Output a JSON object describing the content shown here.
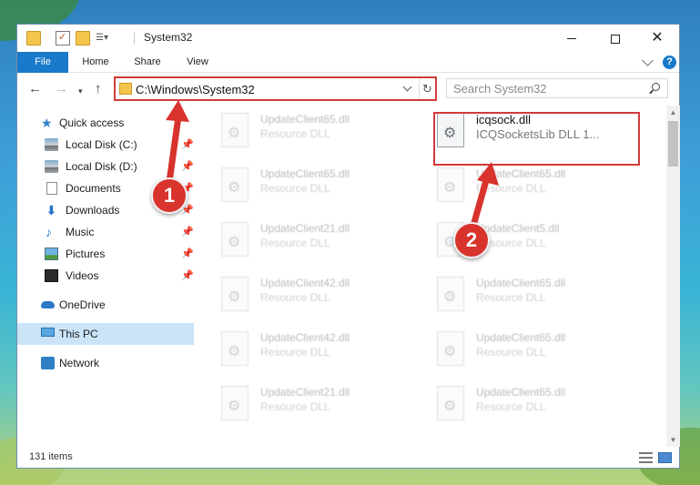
{
  "window": {
    "title": "System32"
  },
  "ribbon": {
    "tabs": [
      "File",
      "Home",
      "Share",
      "View"
    ]
  },
  "address_bar": {
    "path": "C:\\Windows\\System32"
  },
  "search": {
    "placeholder": "Search System32"
  },
  "nav_pane": {
    "items": [
      {
        "label": "Quick access",
        "icon": "star-icon",
        "pinned": false
      },
      {
        "label": "Local Disk (C:)",
        "icon": "drive-icon",
        "pinned": true
      },
      {
        "label": "Local Disk (D:)",
        "icon": "drive-icon",
        "pinned": true
      },
      {
        "label": "Documents",
        "icon": "documents-icon",
        "pinned": true
      },
      {
        "label": "Downloads",
        "icon": "download-icon",
        "pinned": true
      },
      {
        "label": "Music",
        "icon": "music-icon",
        "pinned": true
      },
      {
        "label": "Pictures",
        "icon": "pictures-icon",
        "pinned": true
      },
      {
        "label": "Videos",
        "icon": "videos-icon",
        "pinned": true
      },
      {
        "label": "OneDrive",
        "icon": "cloud-icon",
        "pinned": false
      },
      {
        "label": "This PC",
        "icon": "computer-icon",
        "pinned": false,
        "selected": true
      },
      {
        "label": "Network",
        "icon": "network-icon",
        "pinned": false
      }
    ]
  },
  "files": {
    "left_column": [
      {
        "name": "UpdateClient65.dll",
        "type": "Resource DLL"
      },
      {
        "name": "UpdateClient65.dll",
        "type": "Resource DLL"
      },
      {
        "name": "UpdateClient21.dll",
        "type": "Resource DLL"
      },
      {
        "name": "UpdateClient42.dll",
        "type": "Resource DLL"
      },
      {
        "name": "UpdateClient42.dll",
        "type": "Resource DLL"
      },
      {
        "name": "UpdateClient21.dll",
        "type": "Resource DLL"
      }
    ],
    "right_column": [
      {
        "name": "icqsock.dll",
        "type": "ICQSocketsLib DLL 1..."
      },
      {
        "name": "UpdateClient65.dll",
        "type": "Resource DLL"
      },
      {
        "name": "UpdateClient5.dll",
        "type": "Resource DLL"
      },
      {
        "name": "UpdateClient65.dll",
        "type": "Resource DLL"
      },
      {
        "name": "UpdateClient65.dll",
        "type": "Resource DLL"
      },
      {
        "name": "UpdateClient65.dll",
        "type": "Resource DLL"
      }
    ]
  },
  "status": {
    "item_count": "131 items"
  },
  "annotations": {
    "step1": "1",
    "step2": "2",
    "color": "#d23a3a"
  },
  "colors": {
    "accent": "#1979ca",
    "selection": "#cce4f7"
  }
}
